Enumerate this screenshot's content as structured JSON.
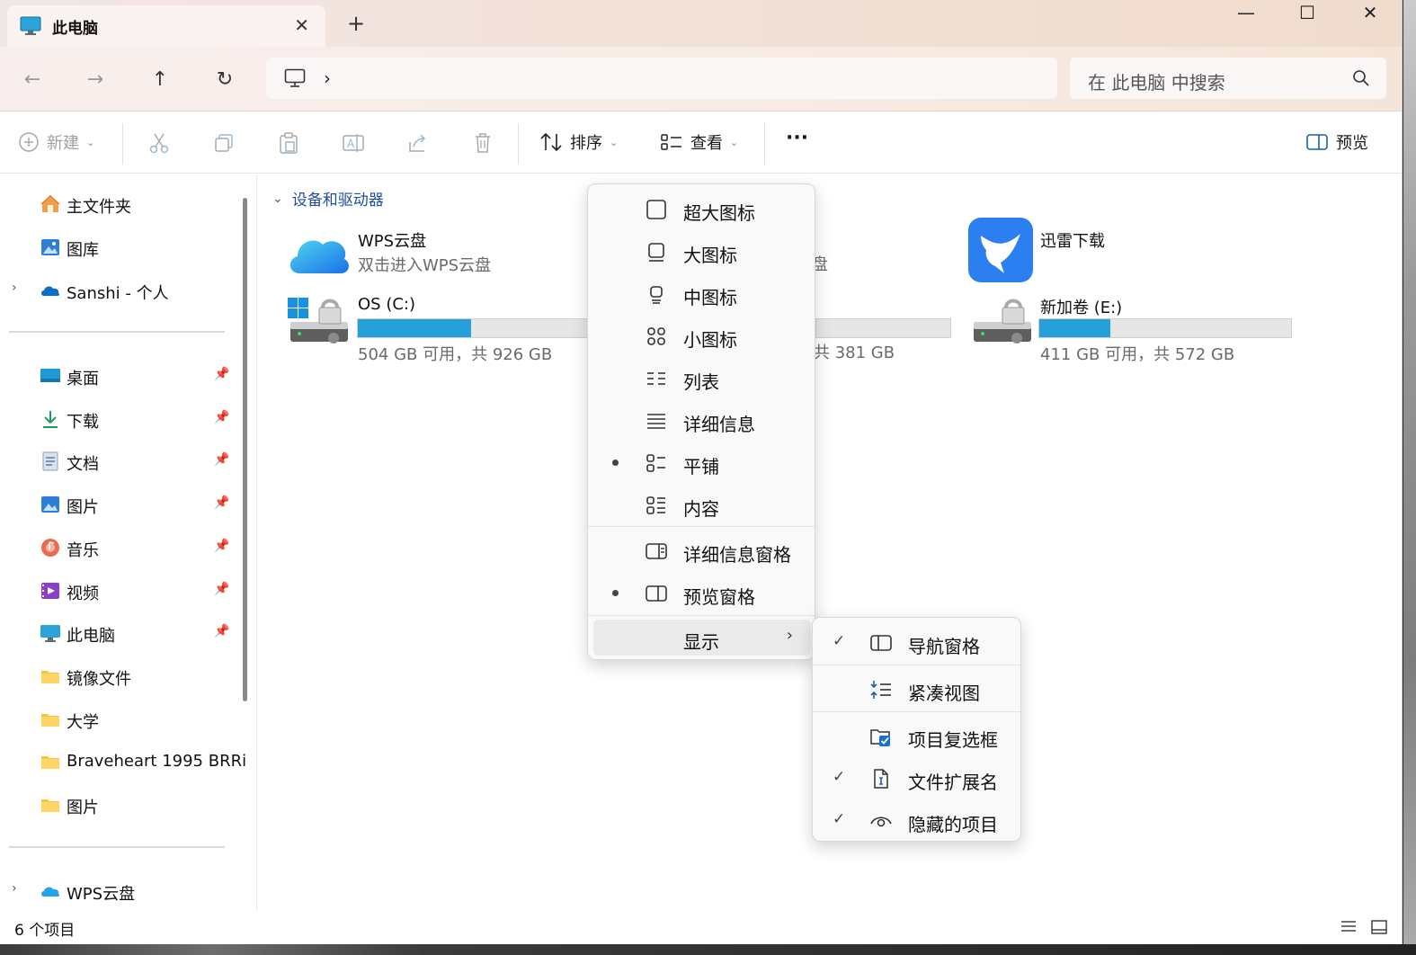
{
  "titlebar": {
    "tab_title": "此电脑",
    "close_glyph": "✕",
    "newtab_glyph": "+"
  },
  "window_controls": {
    "minimize": "—",
    "maximize": "☐",
    "close": "✕"
  },
  "nav": {
    "back": "←",
    "forward": "→",
    "up": "↑",
    "refresh": "↻",
    "breadcrumb_chevron": "›"
  },
  "search": {
    "placeholder": "在 此电脑 中搜索"
  },
  "toolbar": {
    "new_label": "新建",
    "sort_label": "排序",
    "view_label": "查看",
    "more_label": "···",
    "preview_label": "预览"
  },
  "sidebar": {
    "items": [
      {
        "label": "主文件夹",
        "icon": "home-icon"
      },
      {
        "label": "图库",
        "icon": "gallery-icon"
      },
      {
        "label": "Sanshi - 个人",
        "icon": "onedrive-cloud-icon",
        "expandable": true
      },
      {
        "label": "桌面",
        "icon": "desktop-icon",
        "pinned": true
      },
      {
        "label": "下载",
        "icon": "download-icon",
        "pinned": true
      },
      {
        "label": "文档",
        "icon": "document-icon",
        "pinned": true
      },
      {
        "label": "图片",
        "icon": "pictures-icon",
        "pinned": true
      },
      {
        "label": "音乐",
        "icon": "music-icon",
        "pinned": true
      },
      {
        "label": "视频",
        "icon": "video-icon",
        "pinned": true
      },
      {
        "label": "此电脑",
        "icon": "pc-icon",
        "pinned": true
      },
      {
        "label": "镜像文件",
        "icon": "folder-icon"
      },
      {
        "label": "大学",
        "icon": "folder-icon"
      },
      {
        "label": "Braveheart 1995 BRRi",
        "icon": "folder-icon"
      },
      {
        "label": "图片",
        "icon": "folder-icon"
      },
      {
        "label": "WPS云盘",
        "icon": "wps-cloud-icon",
        "expandable": true
      }
    ]
  },
  "content": {
    "group_header": "设备和驱动器",
    "wps": {
      "name": "WPS云盘",
      "subtitle": "双击进入WPS云盘"
    },
    "hidden_sub": "盘",
    "xunlei": {
      "name": "迅雷下载"
    },
    "drive_c": {
      "name": "OS (C:)",
      "usage": "504 GB 可用，共 926 GB",
      "used_fraction": 0.456
    },
    "drive_d": {
      "usage_partial": "共 381 GB"
    },
    "drive_e": {
      "name": "新加卷 (E:)",
      "usage": "411 GB 可用，共 572 GB",
      "used_fraction": 0.281
    }
  },
  "status": {
    "count": "6 个项目"
  },
  "view_menu": {
    "items": [
      {
        "label": "超大图标",
        "icon": "extra-large-icons-icon"
      },
      {
        "label": "大图标",
        "icon": "large-icons-icon"
      },
      {
        "label": "中图标",
        "icon": "medium-icons-icon"
      },
      {
        "label": "小图标",
        "icon": "small-icons-icon"
      },
      {
        "label": "列表",
        "icon": "list-icon"
      },
      {
        "label": "详细信息",
        "icon": "details-icon"
      },
      {
        "label": "平铺",
        "icon": "tiles-icon",
        "selected": true
      },
      {
        "label": "内容",
        "icon": "content-icon"
      },
      {
        "label": "详细信息窗格",
        "icon": "details-pane-icon"
      },
      {
        "label": "预览窗格",
        "icon": "preview-pane-icon",
        "selected": true
      },
      {
        "label": "显示",
        "icon": "",
        "submenu": true
      }
    ]
  },
  "show_submenu": {
    "items": [
      {
        "label": "导航窗格",
        "icon": "navigation-pane-icon",
        "checked": true
      },
      {
        "label": "紧凑视图",
        "icon": "compact-view-icon",
        "checked": false
      },
      {
        "label": "项目复选框",
        "icon": "item-checkbox-icon",
        "checked": false
      },
      {
        "label": "文件扩展名",
        "icon": "file-extension-icon",
        "checked": true
      },
      {
        "label": "隐藏的项目",
        "icon": "hidden-items-icon",
        "checked": true
      }
    ]
  },
  "colors": {
    "accent": "#26a0da",
    "link": "#1f4e9e"
  }
}
